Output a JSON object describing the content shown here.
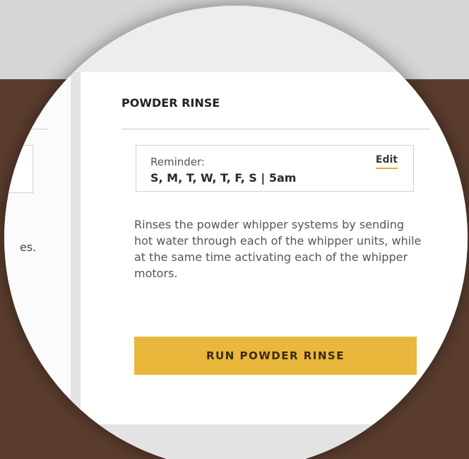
{
  "left_panel": {
    "text_fragment": "es."
  },
  "powder_rinse": {
    "title": "POWDER RINSE",
    "reminder": {
      "label": "Reminder:",
      "schedule": "S, M, T, W, T, F, S | 5am",
      "edit_label": "Edit"
    },
    "description": "Rinses the powder whipper systems by sending hot water through each of the whipper units, while at the same time activating each of the whipper motors.",
    "run_button_label": "RUN POWDER RINSE"
  },
  "colors": {
    "background_brown": "#5b3d2e",
    "accent_yellow": "#e9b73b",
    "edit_underline": "#e2ae36"
  }
}
